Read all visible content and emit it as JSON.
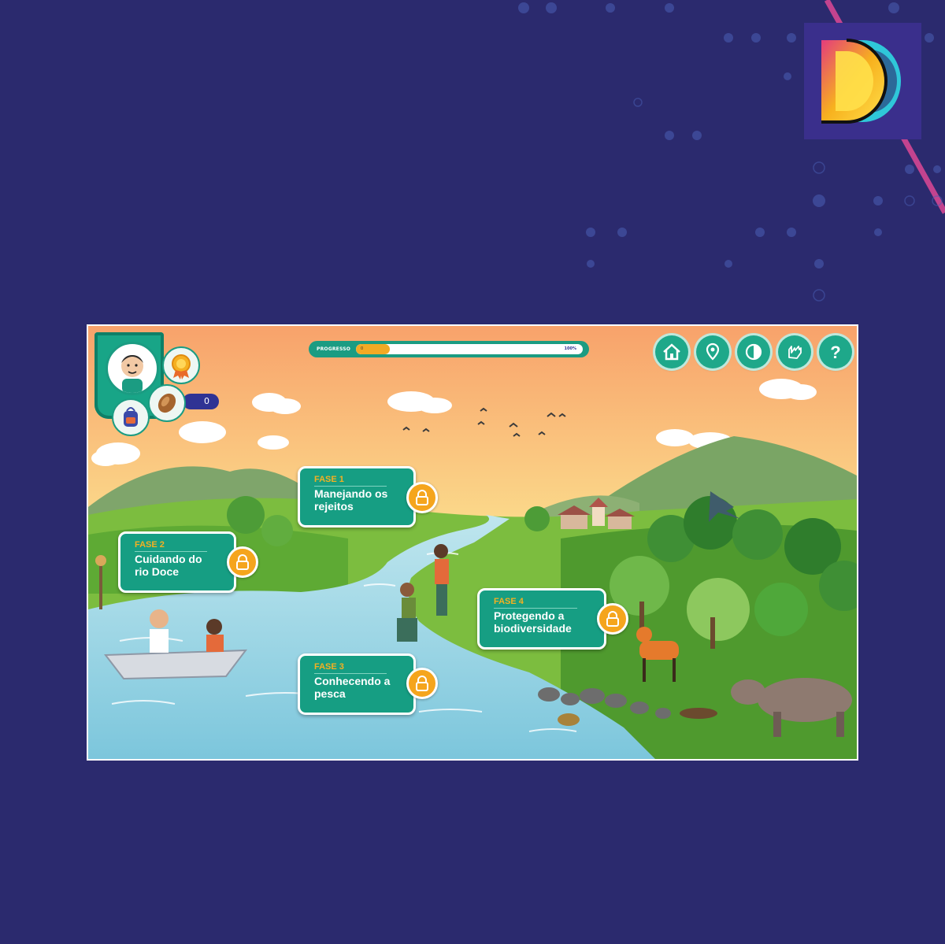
{
  "colors": {
    "background": "#2b2a6e",
    "teal": "#169e83",
    "orange": "#f5a51d",
    "white": "#ffffff"
  },
  "logo": {
    "icon": "d-logo-icon"
  },
  "hud": {
    "coins": "0",
    "progress": {
      "label": "PROGRESSO",
      "min_label": "0",
      "max_label": "100%",
      "value_fraction": 0.15
    },
    "buttons": [
      {
        "name": "home",
        "icon": "home-icon"
      },
      {
        "name": "map",
        "icon": "location-pin-icon"
      },
      {
        "name": "contrast",
        "icon": "contrast-icon"
      },
      {
        "name": "sign-language",
        "icon": "sign-language-icon"
      },
      {
        "name": "help",
        "icon": "help-icon"
      }
    ]
  },
  "phases": [
    {
      "tag": "FASE 1",
      "title": "Manejando os rejeitos",
      "locked": true
    },
    {
      "tag": "FASE 2",
      "title": "Cuidando do rio Doce",
      "locked": true
    },
    {
      "tag": "FASE 3",
      "title": "Conhecendo a pesca",
      "locked": true
    },
    {
      "tag": "FASE 4",
      "title": "Protegendo a biodiversidade",
      "locked": true
    }
  ]
}
